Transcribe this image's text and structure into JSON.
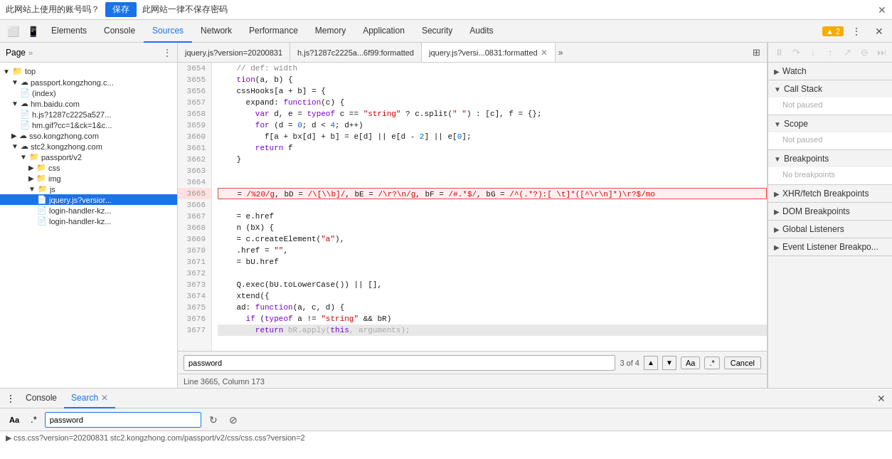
{
  "topbar": {
    "question_text": "此网站上使用的账号吗？",
    "save_label": "保存",
    "no_save_text": "此网站一律不保存密码"
  },
  "devtools": {
    "tabs": [
      {
        "label": "Elements",
        "active": false
      },
      {
        "label": "Console",
        "active": false
      },
      {
        "label": "Sources",
        "active": true
      },
      {
        "label": "Network",
        "active": false
      },
      {
        "label": "Performance",
        "active": false
      },
      {
        "label": "Memory",
        "active": false
      },
      {
        "label": "Application",
        "active": false
      },
      {
        "label": "Security",
        "active": false
      },
      {
        "label": "Audits",
        "active": false
      }
    ],
    "warning_count": "▲ 2"
  },
  "file_panel": {
    "header_label": "Page",
    "tree": [
      {
        "label": "top",
        "indent": 0,
        "type": "folder",
        "icon": "▶"
      },
      {
        "label": "passport.kongzhong.c...",
        "indent": 1,
        "type": "cloud"
      },
      {
        "label": "(index)",
        "indent": 2,
        "type": "file"
      },
      {
        "label": "hm.baidu.com",
        "indent": 1,
        "type": "cloud"
      },
      {
        "label": "h.js?1287c2225a527...",
        "indent": 2,
        "type": "file",
        "color": "yellow"
      },
      {
        "label": "hm.gif?cc=1&ck=1&c...",
        "indent": 2,
        "type": "file"
      },
      {
        "label": "sso.kongzhong.com",
        "indent": 1,
        "type": "cloud"
      },
      {
        "label": "stc2.kongzhong.com",
        "indent": 1,
        "type": "cloud"
      },
      {
        "label": "passport/v2",
        "indent": 2,
        "type": "folder"
      },
      {
        "label": "css",
        "indent": 3,
        "type": "folder",
        "color": "blue"
      },
      {
        "label": "img",
        "indent": 3,
        "type": "folder",
        "color": "blue"
      },
      {
        "label": "js",
        "indent": 3,
        "type": "folder",
        "color": "blue"
      },
      {
        "label": "jquery.js?versior...",
        "indent": 4,
        "type": "file",
        "color": "yellow",
        "selected": true
      },
      {
        "label": "login-handler-kz...",
        "indent": 4,
        "type": "file"
      },
      {
        "label": "login-handler-kz...",
        "indent": 4,
        "type": "file"
      }
    ]
  },
  "code_tabs": [
    {
      "label": "jquery.js?version=20200831",
      "active": false,
      "closeable": false
    },
    {
      "label": "h.js?1287c2225a...6f99:formatted",
      "active": false,
      "closeable": false
    },
    {
      "label": "jquery.js?versi...0831:formatted",
      "active": true,
      "closeable": true
    }
  ],
  "code_lines": [
    {
      "num": "3654",
      "content": "    // def: width"
    },
    {
      "num": "3655",
      "content": "    tion(a, b) {"
    },
    {
      "num": "3656",
      "content": "    cssHooks[a + b] = {"
    },
    {
      "num": "3657",
      "content": "      expand: function(c) {"
    },
    {
      "num": "3658",
      "content": "        var d, e = typeof c == \"string\" ? c.split(\" \") : [c], f = {};"
    },
    {
      "num": "3659",
      "content": "        for (d = 0; d < 4; d++)"
    },
    {
      "num": "3660",
      "content": "          f[a + bx[d] + b] = e[d] || e[d - 2] || e[0];"
    },
    {
      "num": "3661",
      "content": "        return f"
    },
    {
      "num": "3662",
      "content": "    }"
    },
    {
      "num": "3663",
      "content": ""
    },
    {
      "num": "3664",
      "content": ""
    },
    {
      "num": "3665",
      "content": "    = /%20/g, bD = /\\[\\b]/, bE = /\\r?\\n/g, bF = /#.*$/, bG = /^(.*?):[ \\t]*([^\\r\\n]*)\\r?$/mo",
      "highlighted": true
    },
    {
      "num": "3666",
      "content": ""
    },
    {
      "num": "3667",
      "content": "    = e.href"
    },
    {
      "num": "3668",
      "content": "    n (bX) {"
    },
    {
      "num": "3669",
      "content": "    = c.createElement(\"a\"),"
    },
    {
      "num": "3670",
      "content": "    .href = \"\","
    },
    {
      "num": "3671",
      "content": "    = bU.href"
    },
    {
      "num": "3672",
      "content": ""
    },
    {
      "num": "3673",
      "content": "    Q.exec(bU.toLowerCase()) || [],"
    },
    {
      "num": "3674",
      "content": "    xtend({"
    },
    {
      "num": "3675",
      "content": "    ad: function(a, c, d) {"
    },
    {
      "num": "3676",
      "content": "      if (typeof a != \"string\" && bR)"
    },
    {
      "num": "3677",
      "content": "        return bR.apply(this, arguments);"
    }
  ],
  "search_bar": {
    "input_value": "password",
    "count_text": "3 of 4",
    "aa_label": "Aa",
    "dot_label": ".*",
    "cancel_label": "Cancel"
  },
  "status_bar": {
    "text": "Line 3665, Column 173"
  },
  "right_panel": {
    "toolbar_buttons": [
      "⏸",
      "⟳",
      "↓",
      "↑",
      "↗",
      "⤵",
      "⤴"
    ],
    "sections": [
      {
        "label": "Watch",
        "expanded": true,
        "content": null
      },
      {
        "label": "Call Stack",
        "expanded": true,
        "content": "Not paused"
      },
      {
        "label": "Scope",
        "expanded": true,
        "content": "Not paused"
      },
      {
        "label": "Breakpoints",
        "expanded": true,
        "content": "No breakpoints"
      },
      {
        "label": "XHR/fetch Breakpoints",
        "expanded": false,
        "content": null
      },
      {
        "label": "DOM Breakpoints",
        "expanded": false,
        "content": null
      },
      {
        "label": "Global Listeners",
        "expanded": false,
        "content": null
      },
      {
        "label": "Event Listener Breakpo...",
        "expanded": false,
        "content": null
      }
    ]
  },
  "bottom_panel": {
    "tabs": [
      {
        "label": "Console",
        "active": false,
        "closeable": false
      },
      {
        "label": "Search",
        "active": true,
        "closeable": true
      }
    ],
    "search": {
      "input_value": "password",
      "aa_label": "Aa",
      "dot_label": ".*"
    },
    "results": [
      {
        "text": "► css.css?version=20200831  stc2.kongzhong.com/passport/v2/css/css.css?version=2"
      },
      {
        "text": ""
      }
    ]
  }
}
